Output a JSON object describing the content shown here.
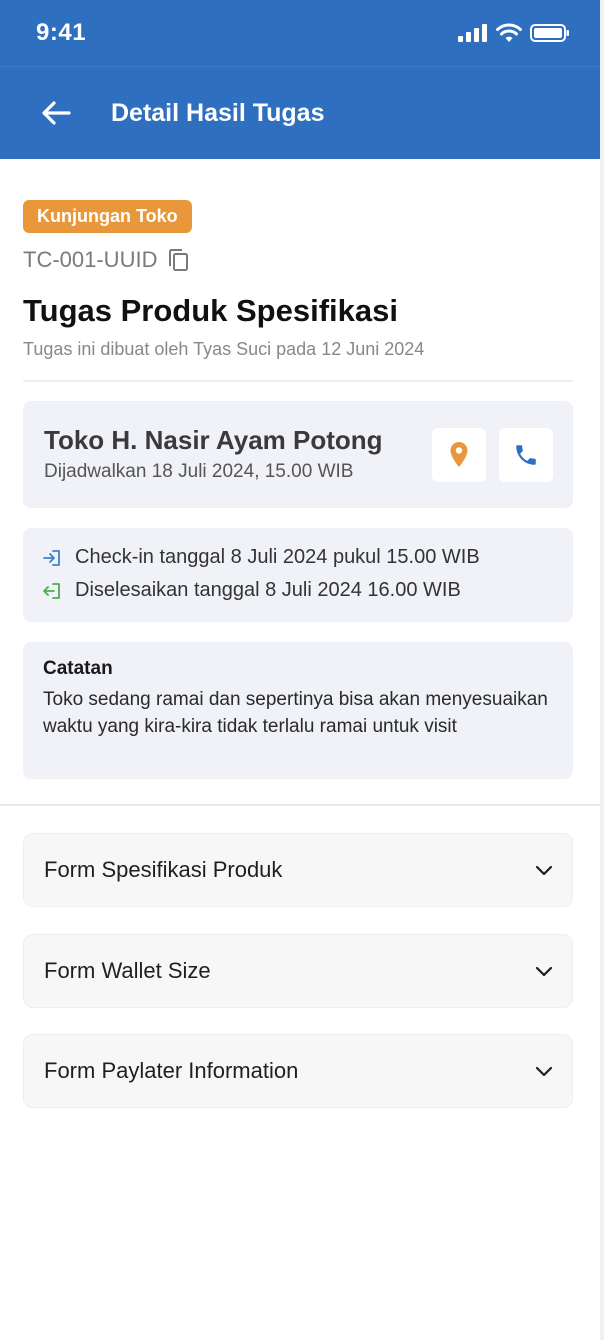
{
  "status_bar": {
    "time": "9:41"
  },
  "app_bar": {
    "title": "Detail Hasil Tugas"
  },
  "task": {
    "badge": "Kunjungan Toko",
    "id": "TC-001-UUID",
    "title": "Tugas Produk Spesifikasi",
    "meta": "Tugas ini dibuat oleh Tyas Suci pada 12 Juni 2024"
  },
  "store": {
    "name": "Toko H. Nasir Ayam Potong",
    "schedule": "Dijadwalkan 18 Juli 2024, 15.00 WIB"
  },
  "log": {
    "checkin": "Check-in tanggal 8 Juli 2024 pukul 15.00 WIB",
    "completed": "Diselesaikan tanggal 8 Juli 2024 16.00 WIB"
  },
  "notes": {
    "title": "Catatan",
    "body": "Toko sedang ramai dan sepertinya bisa akan menyesuaikan waktu yang kira-kira tidak terlalu ramai untuk visit"
  },
  "forms": [
    {
      "label": "Form Spesifikasi Produk"
    },
    {
      "label": "Form Wallet Size"
    },
    {
      "label": "Form Paylater Information"
    }
  ],
  "colors": {
    "primary": "#2f6fc0",
    "badge": "#e8983a",
    "card_bg": "#f0f2f7",
    "checkin_icon": "#3b82d6",
    "completed_icon": "#4caf50"
  }
}
